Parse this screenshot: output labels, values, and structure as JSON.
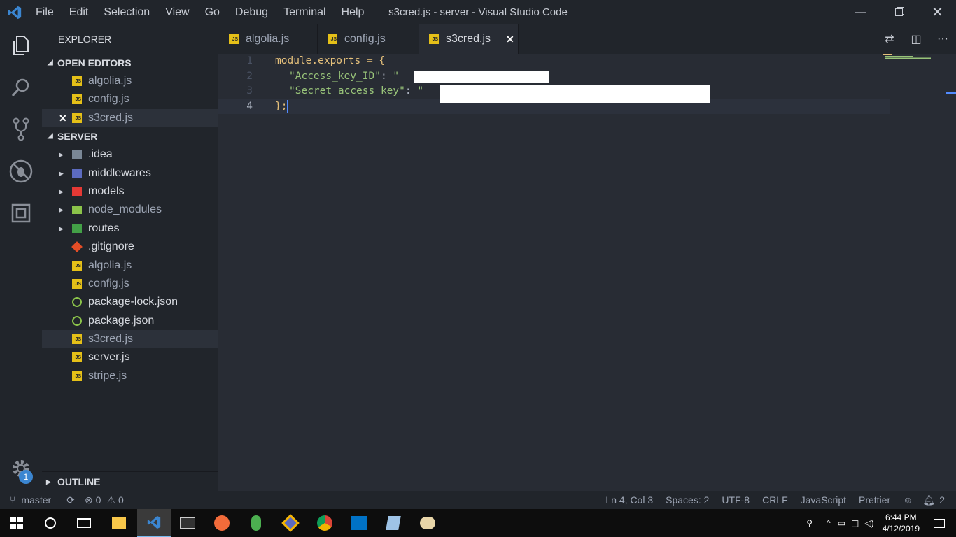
{
  "window": {
    "title": "s3cred.js - server - Visual Studio Code",
    "menu": [
      "File",
      "Edit",
      "Selection",
      "View",
      "Go",
      "Debug",
      "Terminal",
      "Help"
    ],
    "controls": [
      "minimize-icon",
      "restore-icon",
      "close-icon"
    ]
  },
  "activity": {
    "items": [
      "explorer-icon",
      "search-icon",
      "source-control-icon",
      "debug-icon",
      "extensions-icon"
    ],
    "settings_badge": "1"
  },
  "sidebar": {
    "title": "EXPLORER",
    "open_editors_header": "OPEN EDITORS",
    "open_editors": [
      {
        "name": "algolia.js"
      },
      {
        "name": "config.js"
      },
      {
        "name": "s3cred.js",
        "close": "✕"
      }
    ],
    "folder_header": "SERVER",
    "tree": [
      {
        "name": ".idea",
        "type": "folder"
      },
      {
        "name": "middlewares",
        "type": "folder"
      },
      {
        "name": "models",
        "type": "folder"
      },
      {
        "name": "node_modules",
        "type": "folder"
      },
      {
        "name": "routes",
        "type": "folder"
      },
      {
        "name": ".gitignore",
        "type": "file"
      },
      {
        "name": "algolia.js",
        "type": "file"
      },
      {
        "name": "config.js",
        "type": "file"
      },
      {
        "name": "package-lock.json",
        "type": "file"
      },
      {
        "name": "package.json",
        "type": "file"
      },
      {
        "name": "s3cred.js",
        "type": "file"
      },
      {
        "name": "server.js",
        "type": "file"
      },
      {
        "name": "stripe.js",
        "type": "file"
      }
    ],
    "outline_header": "OUTLINE"
  },
  "tabs": [
    {
      "label": "algolia.js"
    },
    {
      "label": "config.js"
    },
    {
      "label": "s3cred.js",
      "close": "✕"
    }
  ],
  "editor": {
    "lines": [
      {
        "num": "1",
        "text": "module.exports = {"
      },
      {
        "num": "2",
        "key": "\"Access_key_ID\"",
        "sep": ": ",
        "val_start": "\"",
        "val_end": "\","
      },
      {
        "num": "3",
        "key": "\"Secret_access_key\"",
        "sep": ": ",
        "val_start": "\"",
        "val_end": "\""
      },
      {
        "num": "4",
        "text": "};"
      }
    ]
  },
  "status": {
    "branch": "master",
    "errors": "0",
    "warnings": "0",
    "position": "Ln 4, Col 3",
    "spaces": "Spaces: 2",
    "encoding": "UTF-8",
    "eol": "CRLF",
    "language": "JavaScript",
    "formatter": "Prettier",
    "notifications": "2"
  },
  "taskbar": {
    "time": "6:44 PM",
    "date": "4/12/2019"
  }
}
